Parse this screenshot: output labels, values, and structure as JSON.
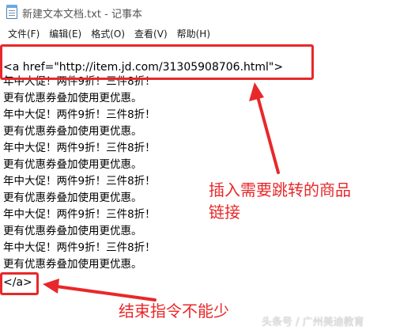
{
  "window": {
    "title": "新建文本文档.txt - 记事本"
  },
  "menu": {
    "items": [
      "文件(F)",
      "编辑(E)",
      "格式(O)",
      "查看(V)",
      "帮助(H)"
    ]
  },
  "editor": {
    "open_tag": "<a href=\"http://item.jd.com/31305908706.html\">",
    "promo_lines": [
      "年中大促！两件9折！三件8折！",
      "更有优惠券叠加使用更优惠。",
      "年中大促！两件9折！三件8折！",
      "更有优惠券叠加使用更优惠。",
      "年中大促！两件9折！三件8折！",
      "更有优惠券叠加使用更优惠。",
      "年中大促！两件9折！三件8折！",
      "更有优惠券叠加使用更优惠。",
      "年中大促！两件9折！三件8折！",
      "更有优惠券叠加使用更优惠。",
      "年中大促！两件9折！三件8折！",
      "更有优惠券叠加使用更优惠。"
    ],
    "close_tag": "</a>"
  },
  "annotations": {
    "insert_note_line1": "插入需要跳转的商品",
    "insert_note_line2": "链接",
    "end_note": "结束指令不能少",
    "color": "#e8282a"
  },
  "watermark": "头条号 / 广州美迪教育"
}
